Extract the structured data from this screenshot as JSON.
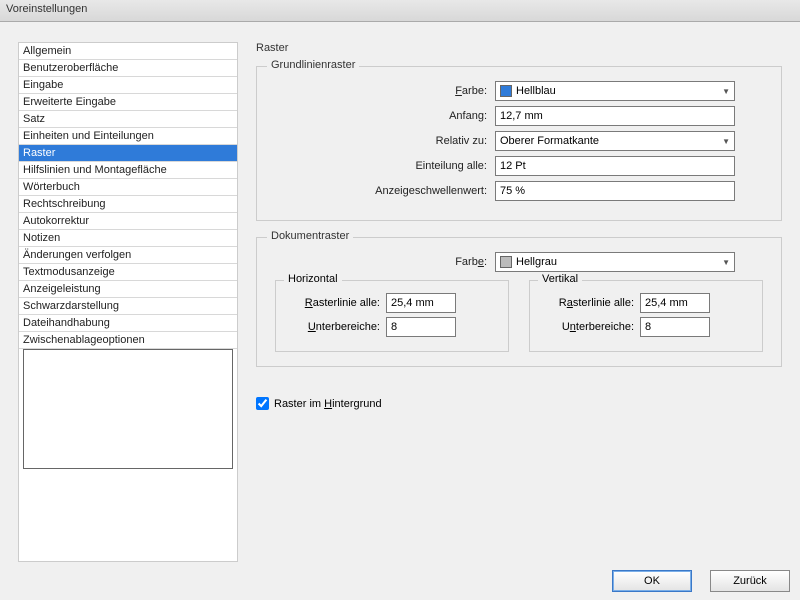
{
  "title": "Voreinstellungen",
  "sidebar": {
    "items": [
      {
        "label": "Allgemein"
      },
      {
        "label": "Benutzeroberfläche"
      },
      {
        "label": "Eingabe"
      },
      {
        "label": "Erweiterte Eingabe"
      },
      {
        "label": "Satz"
      },
      {
        "label": "Einheiten und Einteilungen"
      },
      {
        "label": "Raster"
      },
      {
        "label": "Hilfslinien und Montagefläche"
      },
      {
        "label": "Wörterbuch"
      },
      {
        "label": "Rechtschreibung"
      },
      {
        "label": "Autokorrektur"
      },
      {
        "label": "Notizen"
      },
      {
        "label": "Änderungen verfolgen"
      },
      {
        "label": "Textmodusanzeige"
      },
      {
        "label": "Anzeigeleistung"
      },
      {
        "label": "Schwarzdarstellung"
      },
      {
        "label": "Dateihandhabung"
      },
      {
        "label": "Zwischenablageoptionen"
      }
    ],
    "selected_index": 6
  },
  "main": {
    "heading": "Raster",
    "baseline": {
      "title": "Grundlinienraster",
      "color_label": "Farbe:",
      "color_value": "Hellblau",
      "color_swatch": "#2f7bd9",
      "start_label": "Anfang:",
      "start_value": "12,7 mm",
      "relative_label": "Relativ zu:",
      "relative_value": "Oberer Formatkante",
      "division_label": "Einteilung alle:",
      "division_value": "12 Pt",
      "threshold_label": "Anzeigeschwellenwert:",
      "threshold_value": "75 %"
    },
    "docgrid": {
      "title": "Dokumentraster",
      "color_label": "Farbe:",
      "color_value": "Hellgrau",
      "color_swatch": "#bcbcbc",
      "horiz_title": "Horizontal",
      "vert_title": "Vertikal",
      "gridline_label": "Rasterlinie alle:",
      "sub_label": "Unterbereiche:",
      "h_gridline": "25,4 mm",
      "h_sub": "8",
      "v_gridline": "25,4 mm",
      "v_sub": "8"
    },
    "background_checkbox": "Raster im Hintergrund",
    "background_checked": true
  },
  "buttons": {
    "ok": "OK",
    "back": "Zurück"
  }
}
